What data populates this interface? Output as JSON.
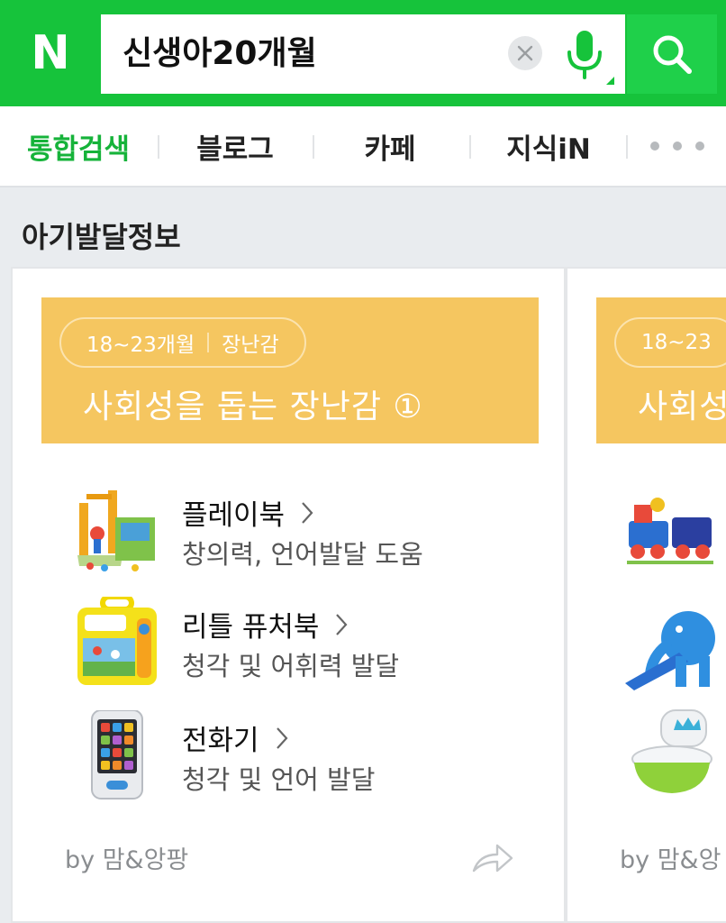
{
  "header": {
    "logo": "N",
    "search": {
      "value": "신생아20개월"
    },
    "icons": {
      "clear": "close-icon",
      "mic": "mic-icon",
      "search": "search-icon"
    }
  },
  "tabs": [
    {
      "label": "통합검색",
      "active": true
    },
    {
      "label": "블로그",
      "active": false
    },
    {
      "label": "카페",
      "active": false
    },
    {
      "label": "지식iN",
      "active": false
    }
  ],
  "section": {
    "title": "아기발달정보",
    "cards": [
      {
        "age": "18~23개월",
        "category": "장난감",
        "title": "사회성을 돕는 장난감 ①",
        "items": [
          {
            "name": "플레이북",
            "desc": "창의력, 언어발달 도움"
          },
          {
            "name": "리틀 퓨처북",
            "desc": "청각 및 어휘력 발달"
          },
          {
            "name": "전화기",
            "desc": "청각 및 언어 발달"
          }
        ],
        "source": "by 맘&앙팡"
      },
      {
        "age": "18~23",
        "title": "사회성",
        "source": "by 맘&앙"
      }
    ]
  },
  "colors": {
    "brand": "#16c33b",
    "banner": "#f5c660",
    "active_tab": "#16b33a"
  }
}
